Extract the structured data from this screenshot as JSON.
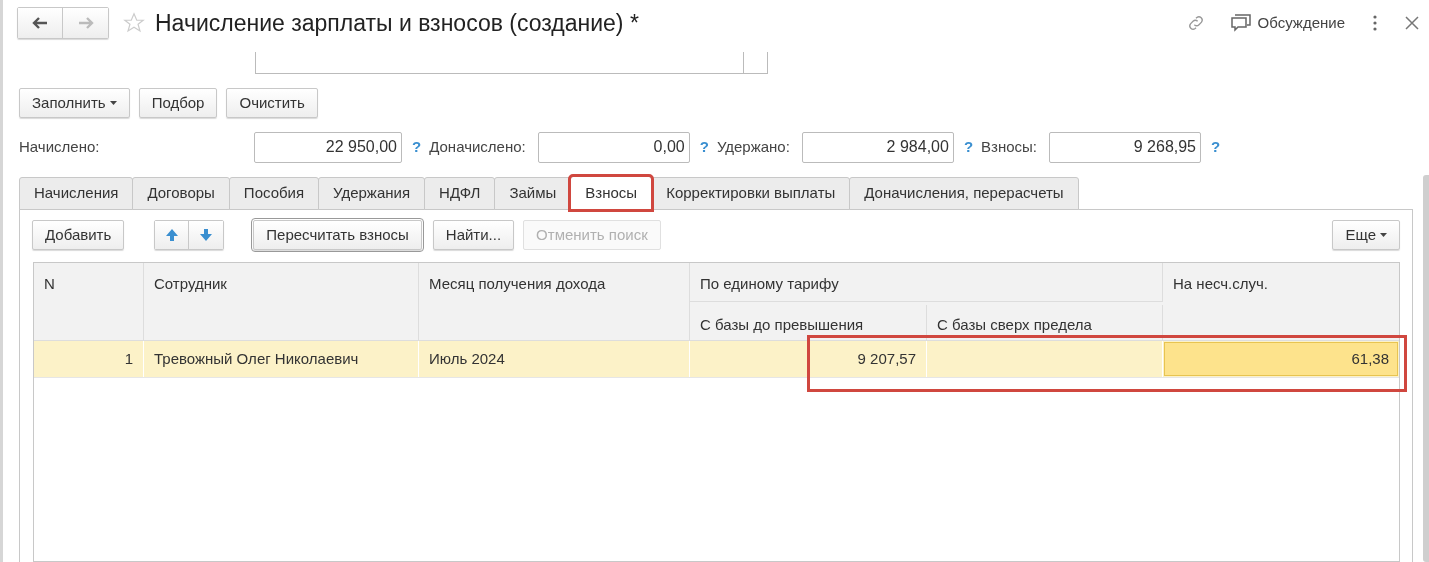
{
  "window": {
    "title": "Начисление зарплаты и взносов (создание) *",
    "discussion": "Обсуждение"
  },
  "fill_buttons": [
    {
      "label": "Заполнить",
      "dropdown": true
    },
    {
      "label": "Подбор",
      "dropdown": false
    },
    {
      "label": "Очистить",
      "dropdown": false
    }
  ],
  "totals": [
    {
      "label": "Начислено:",
      "value": "22 950,00"
    },
    {
      "label": "Доначислено:",
      "value": "0,00"
    },
    {
      "label": "Удержано:",
      "value": "2 984,00"
    },
    {
      "label": "Взносы:",
      "value": "9 268,95"
    }
  ],
  "help_mark": "?",
  "tabs": [
    {
      "label": "Начисления",
      "selected": false
    },
    {
      "label": "Договоры",
      "selected": false
    },
    {
      "label": "Пособия",
      "selected": false
    },
    {
      "label": "Удержания",
      "selected": false
    },
    {
      "label": "НДФЛ",
      "selected": false
    },
    {
      "label": "Займы",
      "selected": false
    },
    {
      "label": "Взносы",
      "selected": true
    },
    {
      "label": "Корректировки выплаты",
      "selected": false
    },
    {
      "label": "Доначисления, перерасчеты",
      "selected": false
    }
  ],
  "toolbar": {
    "add": "Добавить",
    "recalc": "Пересчитать взносы",
    "find": "Найти...",
    "cancel_search": {
      "label": "Отменить поиск",
      "disabled": true
    },
    "more": "Еще"
  },
  "table": {
    "columns": {
      "n": "N",
      "employee": "Сотрудник",
      "month": "Месяц получения дохода",
      "group": "По единому тарифу",
      "base_below": "С базы до превышения",
      "base_above": "С базы сверх предела",
      "accident": "На несч.случ."
    },
    "rows": [
      {
        "n": "1",
        "employee": "Тревожный Олег Николаевич",
        "month": "Июль 2024",
        "base_below": "9 207,57",
        "accident": "61,38",
        "selected": true
      }
    ]
  }
}
